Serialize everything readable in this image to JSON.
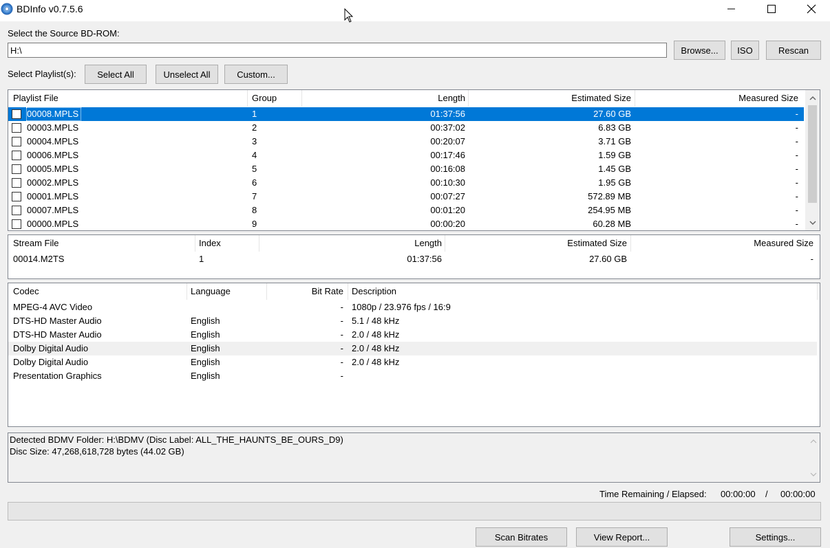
{
  "window": {
    "title": "BDInfo v0.7.5.6",
    "icon": "disc-icon"
  },
  "source": {
    "label": "Select the Source BD-ROM:",
    "value": "H:\\",
    "browse_label": "Browse...",
    "iso_label": "ISO",
    "rescan_label": "Rescan"
  },
  "playlists": {
    "label": "Select Playlist(s):",
    "select_all_label": "Select All",
    "unselect_all_label": "Unselect All",
    "custom_label": "Custom...",
    "columns": [
      "Playlist File",
      "Group",
      "Length",
      "Estimated Size",
      "Measured Size"
    ],
    "rows": [
      {
        "file": "00008.MPLS",
        "group": "1",
        "length": "01:37:56",
        "estimated": "27.60 GB",
        "measured": "-",
        "selected": true
      },
      {
        "file": "00003.MPLS",
        "group": "2",
        "length": "00:37:02",
        "estimated": "6.83 GB",
        "measured": "-"
      },
      {
        "file": "00004.MPLS",
        "group": "3",
        "length": "00:20:07",
        "estimated": "3.71 GB",
        "measured": "-"
      },
      {
        "file": "00006.MPLS",
        "group": "4",
        "length": "00:17:46",
        "estimated": "1.59 GB",
        "measured": "-"
      },
      {
        "file": "00005.MPLS",
        "group": "5",
        "length": "00:16:08",
        "estimated": "1.45 GB",
        "measured": "-"
      },
      {
        "file": "00002.MPLS",
        "group": "6",
        "length": "00:10:30",
        "estimated": "1.95 GB",
        "measured": "-"
      },
      {
        "file": "00001.MPLS",
        "group": "7",
        "length": "00:07:27",
        "estimated": "572.89 MB",
        "measured": "-"
      },
      {
        "file": "00007.MPLS",
        "group": "8",
        "length": "00:01:20",
        "estimated": "254.95 MB",
        "measured": "-"
      },
      {
        "file": "00000.MPLS",
        "group": "9",
        "length": "00:00:20",
        "estimated": "60.28 MB",
        "measured": "-"
      }
    ]
  },
  "streams": {
    "columns": [
      "Stream File",
      "Index",
      "Length",
      "Estimated Size",
      "Measured Size"
    ],
    "rows": [
      {
        "file": "00014.M2TS",
        "index": "1",
        "length": "01:37:56",
        "estimated": "27.60 GB",
        "measured": "-"
      }
    ]
  },
  "codecs": {
    "columns": [
      "Codec",
      "Language",
      "Bit Rate",
      "Description"
    ],
    "rows": [
      {
        "codec": "MPEG-4 AVC Video",
        "language": "",
        "bitrate": "-",
        "description": "1080p / 23.976 fps / 16:9"
      },
      {
        "codec": "DTS-HD Master Audio",
        "language": "English",
        "bitrate": "-",
        "description": "5.1 / 48 kHz"
      },
      {
        "codec": "DTS-HD Master Audio",
        "language": "English",
        "bitrate": "-",
        "description": "2.0 / 48 kHz"
      },
      {
        "codec": "Dolby Digital Audio",
        "language": "English",
        "bitrate": "-",
        "description": "2.0 / 48 kHz",
        "hover": true
      },
      {
        "codec": "Dolby Digital Audio",
        "language": "English",
        "bitrate": "-",
        "description": "2.0 / 48 kHz"
      },
      {
        "codec": "Presentation Graphics",
        "language": "English",
        "bitrate": "-",
        "description": ""
      }
    ]
  },
  "log": {
    "lines": [
      "Detected BDMV Folder: H:\\BDMV (Disc Label: ALL_THE_HAUNTS_BE_OURS_D9)",
      "Disc Size: 47,268,618,728 bytes (44.02 GB)"
    ]
  },
  "timing": {
    "label": "Time Remaining / Elapsed:",
    "remaining": "00:00:00",
    "separator": "/",
    "elapsed": "00:00:00"
  },
  "progress": {
    "fraction": 0
  },
  "footer": {
    "scan_label": "Scan Bitrates",
    "report_label": "View Report...",
    "settings_label": "Settings..."
  }
}
